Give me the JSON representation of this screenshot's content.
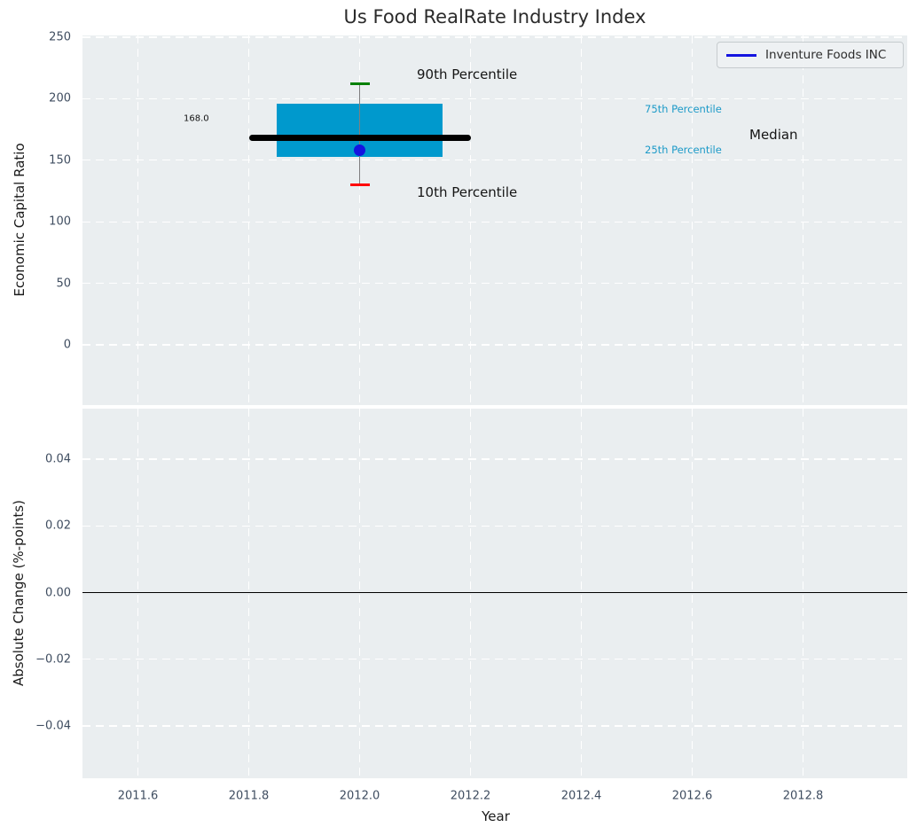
{
  "figure": {
    "title": "Us Food RealRate Industry Index"
  },
  "chart_data": [
    {
      "type": "box",
      "subplot": "top",
      "title": "Us Food RealRate Industry Index",
      "ylabel": "Economic Capital Ratio",
      "ylim": [
        -49,
        251
      ],
      "yticks": [
        250,
        200,
        150,
        100,
        50,
        0
      ],
      "grid": true,
      "legend": {
        "position": "upper right",
        "entries": [
          {
            "label": "Inventure Foods INC",
            "color": "#1414e0"
          }
        ]
      },
      "x_center": 2012.0,
      "box": {
        "x_start": 2011.85,
        "x_end": 2012.15,
        "p25": 153,
        "p75": 196
      },
      "median": {
        "value": 168.0,
        "annotation": "168.0",
        "x_start": 2011.8,
        "x_end": 2012.2
      },
      "whiskers": {
        "p90": 212,
        "p10": 130
      },
      "company_point": {
        "x": 2012.0,
        "value": 158
      },
      "labels": {
        "p90": "90th Percentile",
        "p10": "10th Percentile",
        "p75": "75th Percentile",
        "p25": "25th Percentile",
        "median": "Median"
      },
      "colors": {
        "box": "#0099cd",
        "median": "#000000",
        "whisker_line": "#7f7f7f",
        "cap_top": "#008000",
        "cap_bottom": "#ff0000",
        "point": "#1414e0",
        "percentile_labels": "#1c9ac8",
        "axes_background": "#eaeef0",
        "grid": "#ffffff"
      }
    },
    {
      "type": "line",
      "subplot": "bottom",
      "ylabel": "Absolute Change (%-points)",
      "xlabel": "Year",
      "ylim": [
        -0.055,
        0.055
      ],
      "yticks": [
        0.04,
        0.02,
        0,
        -0.02,
        -0.04
      ],
      "xlim": [
        2011.5,
        2012.99
      ],
      "xticks": [
        2011.6,
        2011.8,
        2012.0,
        2012.2,
        2012.4,
        2012.6,
        2012.8
      ],
      "zero_line": 0,
      "series": [],
      "grid": true
    }
  ]
}
